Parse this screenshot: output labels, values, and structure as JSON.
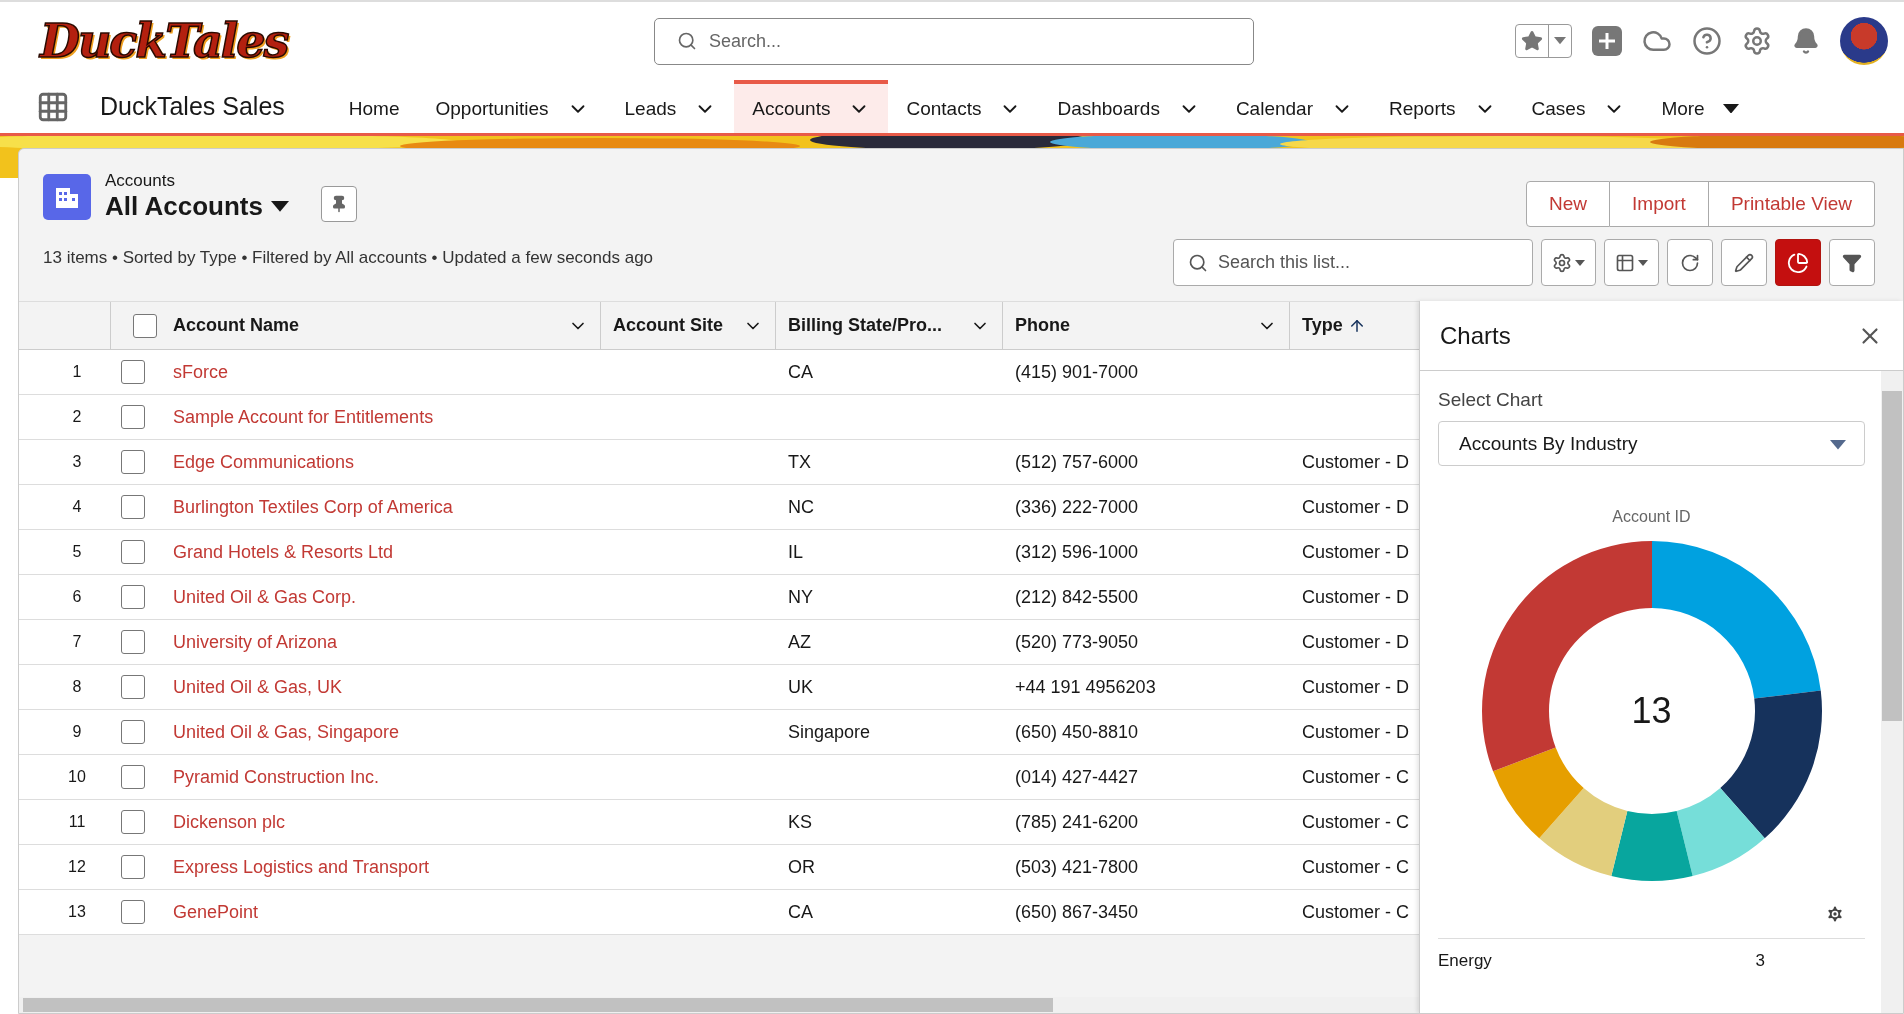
{
  "logo": "DuckTales",
  "search": {
    "placeholder": "Search..."
  },
  "app_name": "DuckTales Sales",
  "nav": [
    {
      "label": "Home",
      "selected": false,
      "kind": "plain"
    },
    {
      "label": "Opportunities",
      "selected": false,
      "kind": "menu"
    },
    {
      "label": "Leads",
      "selected": false,
      "kind": "menu"
    },
    {
      "label": "Accounts",
      "selected": true,
      "kind": "menu"
    },
    {
      "label": "Contacts",
      "selected": false,
      "kind": "menu"
    },
    {
      "label": "Dashboards",
      "selected": false,
      "kind": "menu"
    },
    {
      "label": "Calendar",
      "selected": false,
      "kind": "menu"
    },
    {
      "label": "Reports",
      "selected": false,
      "kind": "menu"
    },
    {
      "label": "Cases",
      "selected": false,
      "kind": "menu"
    },
    {
      "label": "More",
      "selected": false,
      "kind": "overflow"
    }
  ],
  "list_header": {
    "object": "Accounts",
    "view": "All Accounts",
    "status": "13 items • Sorted by Type • Filtered by All accounts • Updated a few seconds ago",
    "search_placeholder": "Search this list..."
  },
  "actions": [
    "New",
    "Import",
    "Printable View"
  ],
  "toolbar": [
    {
      "kind": "settings",
      "selected": false
    },
    {
      "kind": "columns",
      "selected": false
    },
    {
      "kind": "refresh",
      "selected": false
    },
    {
      "kind": "edit",
      "selected": false
    },
    {
      "kind": "chart",
      "selected": true
    },
    {
      "kind": "filter",
      "selected": false
    }
  ],
  "table": {
    "select_all_checked": false,
    "columns": [
      {
        "label": "Account Name",
        "sorted": false
      },
      {
        "label": "Account Site",
        "sorted": false
      },
      {
        "label": "Billing State/Pro...",
        "sorted": false
      },
      {
        "label": "Phone",
        "sorted": false
      },
      {
        "label": "Type",
        "sorted": true
      }
    ],
    "rows": [
      {
        "number": "1",
        "name": "sForce",
        "state": "CA",
        "phone": "(415) 901-7000",
        "checked": false
      },
      {
        "number": "2",
        "name": "Sample Account for Entitlements",
        "checked": false
      },
      {
        "number": "3",
        "name": "Edge Communications",
        "state": "TX",
        "phone": "(512) 757-6000",
        "type": "Customer - D",
        "checked": false
      },
      {
        "number": "4",
        "name": "Burlington Textiles Corp of America",
        "state": "NC",
        "phone": "(336) 222-7000",
        "type": "Customer - D",
        "checked": false
      },
      {
        "number": "5",
        "name": "Grand Hotels & Resorts Ltd",
        "state": "IL",
        "phone": "(312) 596-1000",
        "type": "Customer - D",
        "checked": false
      },
      {
        "number": "6",
        "name": "United Oil & Gas Corp.",
        "state": "NY",
        "phone": "(212) 842-5500",
        "type": "Customer - D",
        "checked": false
      },
      {
        "number": "7",
        "name": "University of Arizona",
        "state": "AZ",
        "phone": "(520) 773-9050",
        "type": "Customer - D",
        "checked": false
      },
      {
        "number": "8",
        "name": "United Oil & Gas, UK",
        "state": "UK",
        "phone": "+44 191 4956203",
        "type": "Customer - D",
        "checked": false
      },
      {
        "number": "9",
        "name": "United Oil & Gas, Singapore",
        "state": "Singapore",
        "phone": "(650) 450-8810",
        "type": "Customer - D",
        "checked": false
      },
      {
        "number": "10",
        "name": "Pyramid Construction Inc.",
        "phone": "(014) 427-4427",
        "type": "Customer - C",
        "checked": false
      },
      {
        "number": "11",
        "name": "Dickenson plc",
        "state": "KS",
        "phone": "(785) 241-6200",
        "type": "Customer - C",
        "checked": false
      },
      {
        "number": "12",
        "name": "Express Logistics and Transport",
        "state": "OR",
        "phone": "(503) 421-7800",
        "type": "Customer - C",
        "checked": false
      },
      {
        "number": "13",
        "name": "GenePoint",
        "state": "CA",
        "phone": "(650) 867-3450",
        "type": "Customer - C",
        "checked": false
      }
    ]
  },
  "charts_panel": {
    "title": "Charts",
    "select_label": "Select Chart",
    "selected_chart": "Accounts By Industry",
    "chart_title": "Account ID",
    "total": "13",
    "legend": [
      {
        "label": "Energy",
        "value": "3"
      }
    ]
  }
}
